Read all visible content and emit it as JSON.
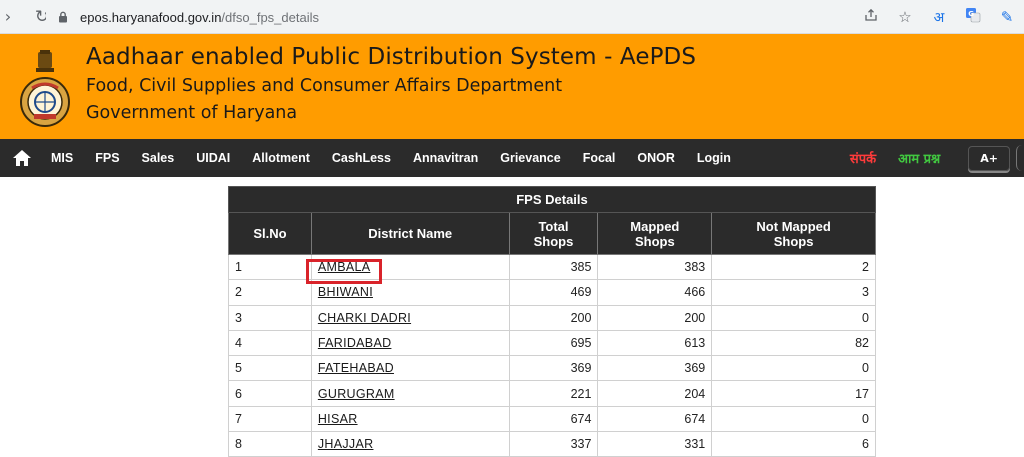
{
  "browser": {
    "url_domain": "epos.haryanafood.gov.in",
    "url_path": "/dfso_fps_details",
    "hindi_icon_text": "अ"
  },
  "header": {
    "title": "Aadhaar enabled Public Distribution System - AePDS",
    "subtitle": "Food, Civil Supplies and Consumer Affairs Department",
    "government": "Government of Haryana"
  },
  "nav": {
    "items": [
      "MIS",
      "FPS",
      "Sales",
      "UIDAI",
      "Allotment",
      "CashLess",
      "Annavitran",
      "Grievance",
      "Focal",
      "ONOR",
      "Login"
    ],
    "sampark": "संपर्क",
    "aam_prashn": "आम प्रश्न",
    "font_increase": "A+"
  },
  "table": {
    "caption": "FPS Details",
    "headers": {
      "sl": "Sl.No",
      "district": "District Name",
      "total_1": "Total",
      "total_2": "Shops",
      "mapped_1": "Mapped",
      "mapped_2": "Shops",
      "notmapped_1": "Not Mapped",
      "notmapped_2": "Shops"
    },
    "rows": [
      {
        "sl": "1",
        "district": "AMBALA",
        "total": "385",
        "mapped": "383",
        "not_mapped": "2"
      },
      {
        "sl": "2",
        "district": "BHIWANI",
        "total": "469",
        "mapped": "466",
        "not_mapped": "3"
      },
      {
        "sl": "3",
        "district": "CHARKI DADRI",
        "total": "200",
        "mapped": "200",
        "not_mapped": "0"
      },
      {
        "sl": "4",
        "district": "FARIDABAD",
        "total": "695",
        "mapped": "613",
        "not_mapped": "82"
      },
      {
        "sl": "5",
        "district": "FATEHABAD",
        "total": "369",
        "mapped": "369",
        "not_mapped": "0"
      },
      {
        "sl": "6",
        "district": "GURUGRAM",
        "total": "221",
        "mapped": "204",
        "not_mapped": "17"
      },
      {
        "sl": "7",
        "district": "HISAR",
        "total": "674",
        "mapped": "674",
        "not_mapped": "0"
      },
      {
        "sl": "8",
        "district": "JHAJJAR",
        "total": "337",
        "mapped": "331",
        "not_mapped": "6"
      }
    ]
  },
  "colors": {
    "header_bg": "#ff9c00",
    "nav_bg": "#2b2b2b",
    "highlight": "#d9232a"
  }
}
